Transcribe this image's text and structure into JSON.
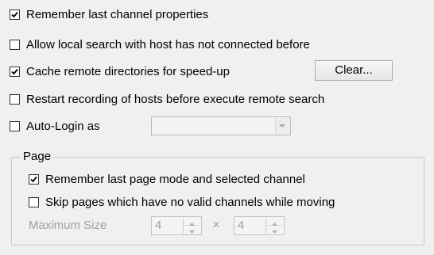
{
  "options": [
    {
      "label": "Remember last channel properties",
      "checked": true
    },
    {
      "label": "Allow local search with host has not connected before",
      "checked": false
    },
    {
      "label": "Cache remote directories for speed-up",
      "checked": true
    },
    {
      "label": "Restart recording of hosts before execute remote search",
      "checked": false
    },
    {
      "label": "Auto-Login as",
      "checked": false
    }
  ],
  "clear_button": {
    "label": "Clear..."
  },
  "auto_login_combo": {
    "value": "",
    "enabled": false
  },
  "page_group": {
    "title": "Page",
    "options": [
      {
        "label": "Remember last page mode and selected channel",
        "checked": true
      },
      {
        "label": "Skip pages which have no valid channels while moving",
        "checked": false
      }
    ],
    "max_size": {
      "label": "Maximum Size",
      "width": "4",
      "separator": "×",
      "height": "4",
      "enabled": false
    }
  },
  "icons": {
    "check": "checkmark-icon",
    "dropdown": "chevron-down-icon",
    "spin_up": "triangle-up-icon",
    "spin_down": "triangle-down-icon"
  },
  "colors": {
    "background": "#f0f0f0",
    "disabled_text": "#a0a0a0",
    "group_border": "#c8c8c8"
  }
}
